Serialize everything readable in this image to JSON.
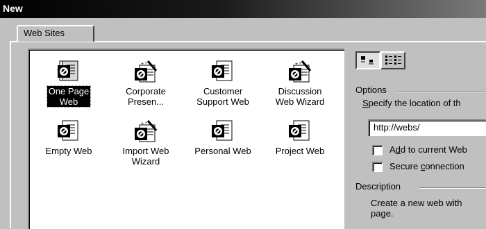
{
  "window": {
    "title": "New"
  },
  "tabs": [
    {
      "label": "Web Sites"
    }
  ],
  "templates": [
    {
      "line1": "One Page",
      "line2": "Web",
      "icon": "web-page-icon",
      "selected": true
    },
    {
      "line1": "Corporate",
      "line2": "Presen...",
      "icon": "wizard-icon"
    },
    {
      "line1": "Customer",
      "line2": "Support Web",
      "icon": "web-page-icon"
    },
    {
      "line1": "Discussion",
      "line2": "Web Wizard",
      "icon": "wizard-icon"
    },
    {
      "line1": "Empty Web",
      "line2": "",
      "icon": "web-page-icon"
    },
    {
      "line1": "Import Web",
      "line2": "Wizard",
      "icon": "wizard-icon"
    },
    {
      "line1": "Personal Web",
      "line2": "",
      "icon": "web-page-icon"
    },
    {
      "line1": "Project Web",
      "line2": "",
      "icon": "web-page-icon"
    }
  ],
  "view_buttons": {
    "large_icons": "large-icons-view-icon",
    "list": "list-view-icon"
  },
  "options": {
    "group_label": "Options",
    "location_label_s": "S",
    "location_label_rest": "pecify the location of th",
    "location_value": "http://webs/",
    "add_to_current_pre": "A",
    "add_to_current_u": "d",
    "add_to_current_post": "d to current Web",
    "secure_pre": "Secure ",
    "secure_u": "c",
    "secure_post": "onnection"
  },
  "description": {
    "group_label": "Description",
    "text_line1": "Create a new web with",
    "text_line2": "page."
  }
}
